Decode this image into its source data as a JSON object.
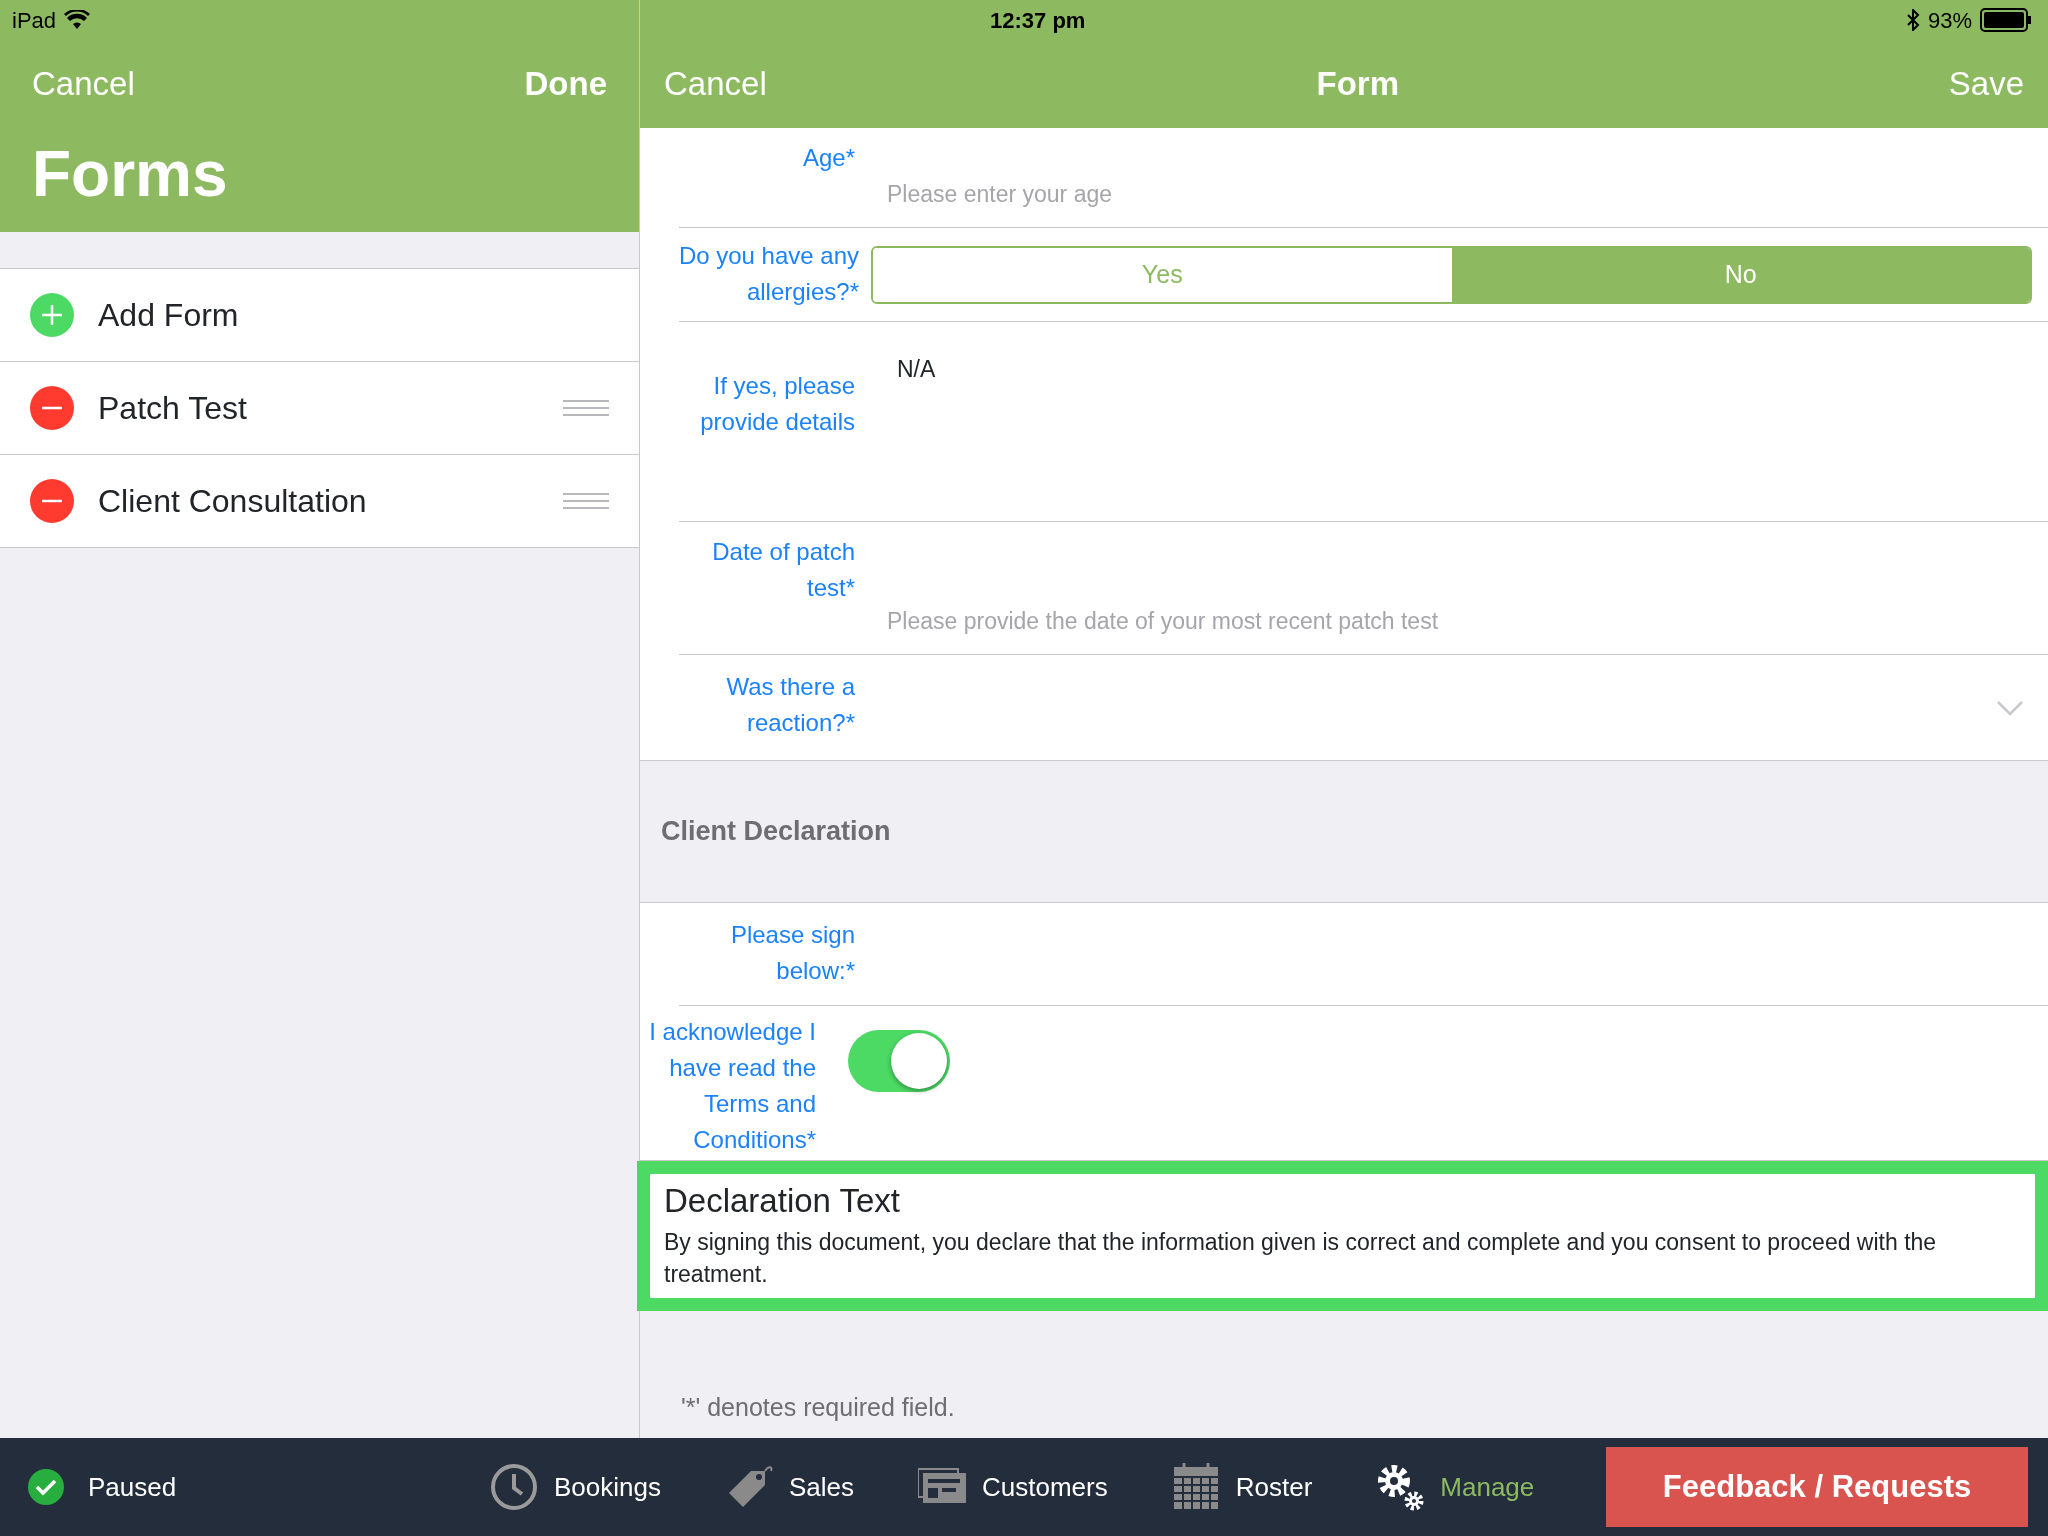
{
  "status_bar": {
    "carrier": "iPad",
    "time": "12:37 pm",
    "battery": "93%"
  },
  "forms_panel": {
    "cancel": "Cancel",
    "done": "Done",
    "title": "Forms",
    "items": [
      {
        "kind": "add",
        "label": "Add Form"
      },
      {
        "kind": "remove",
        "label": "Patch Test"
      },
      {
        "kind": "remove",
        "label": "Client Consultation"
      }
    ]
  },
  "form": {
    "cancel": "Cancel",
    "title": "Form",
    "save": "Save",
    "fields": [
      {
        "kind": "text",
        "label": "Age*",
        "placeholder": "Please enter your age"
      },
      {
        "kind": "segmented",
        "label": "Do you have any allergies?*",
        "options": [
          {
            "label": "Yes",
            "selected": false
          },
          {
            "label": "No",
            "selected": true
          }
        ]
      },
      {
        "kind": "textarea",
        "label": "If yes, please provide details",
        "value": "N/A"
      },
      {
        "kind": "text",
        "label": "Date of patch test*",
        "placeholder": "Please provide the date of your most recent patch test"
      },
      {
        "kind": "dropdown",
        "label": "Was there a reaction?*"
      },
      {
        "kind": "section",
        "label": "Client Declaration"
      },
      {
        "kind": "signature",
        "label": "Please sign below:*"
      },
      {
        "kind": "toggle",
        "label": "I acknowledge I have read the Terms and Conditions*",
        "on": true
      },
      {
        "kind": "declaration",
        "label": "Declaration Text",
        "text": "By signing this document, you declare that the information given is correct and complete and you consent to proceed with the treatment."
      }
    ],
    "footnote": "'*' denotes required field."
  },
  "tab_bar": {
    "status": "Paused",
    "tabs": [
      {
        "label": "Bookings",
        "selected": false
      },
      {
        "label": "Sales",
        "selected": false
      },
      {
        "label": "Customers",
        "selected": false
      },
      {
        "label": "Roster",
        "selected": false
      },
      {
        "label": "Manage",
        "selected": true
      }
    ],
    "feedback": "Feedback / Requests"
  }
}
